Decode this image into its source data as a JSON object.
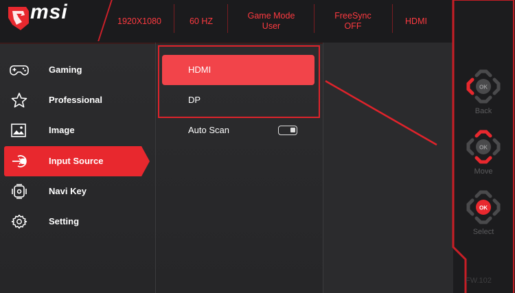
{
  "brand": {
    "logo_text": "msi"
  },
  "status_bar": {
    "resolution": "1920X1080",
    "refresh": "60 HZ",
    "game_mode_label": "Game Mode",
    "game_mode_value": "User",
    "freesync_label": "FreeSync",
    "freesync_value": "OFF",
    "input": "HDMI"
  },
  "menu": {
    "items": [
      {
        "label": "Gaming",
        "icon": "gamepad-icon"
      },
      {
        "label": "Professional",
        "icon": "star-icon"
      },
      {
        "label": "Image",
        "icon": "image-icon"
      },
      {
        "label": "Input Source",
        "icon": "input-source-icon",
        "active": true
      },
      {
        "label": "Navi Key",
        "icon": "navi-key-icon"
      },
      {
        "label": "Setting",
        "icon": "gear-icon"
      }
    ]
  },
  "submenu": {
    "items": [
      {
        "label": "HDMI",
        "active": true
      },
      {
        "label": "DP"
      },
      {
        "label": "Auto Scan",
        "toggle": true
      }
    ]
  },
  "keys": {
    "back": "Back",
    "move": "Move",
    "select": "Select",
    "ok": "OK"
  },
  "firmware": "FW.102",
  "colors": {
    "accent": "#e8282e",
    "text": "#ffffff",
    "status": "#ff3a40"
  }
}
